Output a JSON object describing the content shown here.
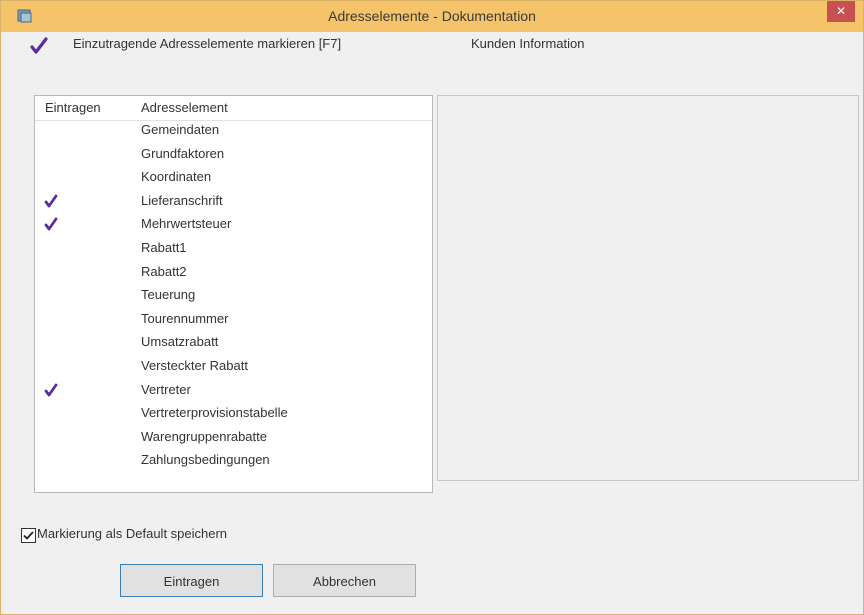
{
  "window": {
    "title": "Adresselemente - Dokumentation",
    "close_glyph": "✕"
  },
  "toolbar": {
    "mark_label": "Einzutragende Adresselemente markieren [F7]",
    "info_label": "Kunden Information"
  },
  "list": {
    "headers": {
      "col1": "Eintragen",
      "col2": "Adresselement"
    },
    "rows": [
      {
        "label": "Gemeindaten",
        "checked": false
      },
      {
        "label": "Grundfaktoren",
        "checked": false
      },
      {
        "label": "Koordinaten",
        "checked": false
      },
      {
        "label": "Lieferanschrift",
        "checked": true
      },
      {
        "label": "Mehrwertsteuer",
        "checked": true
      },
      {
        "label": "Rabatt1",
        "checked": false
      },
      {
        "label": "Rabatt2",
        "checked": false
      },
      {
        "label": "Teuerung",
        "checked": false
      },
      {
        "label": "Tourennummer",
        "checked": false
      },
      {
        "label": "Umsatzrabatt",
        "checked": false
      },
      {
        "label": "Versteckter Rabatt",
        "checked": false
      },
      {
        "label": "Vertreter",
        "checked": true
      },
      {
        "label": "Vertreterprovisionstabelle",
        "checked": false
      },
      {
        "label": "Warengruppenrabatte",
        "checked": false
      },
      {
        "label": "Zahlungsbedingungen",
        "checked": false
      }
    ]
  },
  "options": {
    "default_label": "Markierung als Default speichern",
    "default_checked": true
  },
  "buttons": {
    "ok": "Eintragen",
    "cancel": "Abbrechen"
  },
  "colors": {
    "titlebar": "#f5c36a",
    "checkmark": "#5a2ca0",
    "close": "#c75050"
  },
  "icons": {
    "app": "app-icon",
    "check": "checkmark-icon",
    "close": "close-icon"
  }
}
